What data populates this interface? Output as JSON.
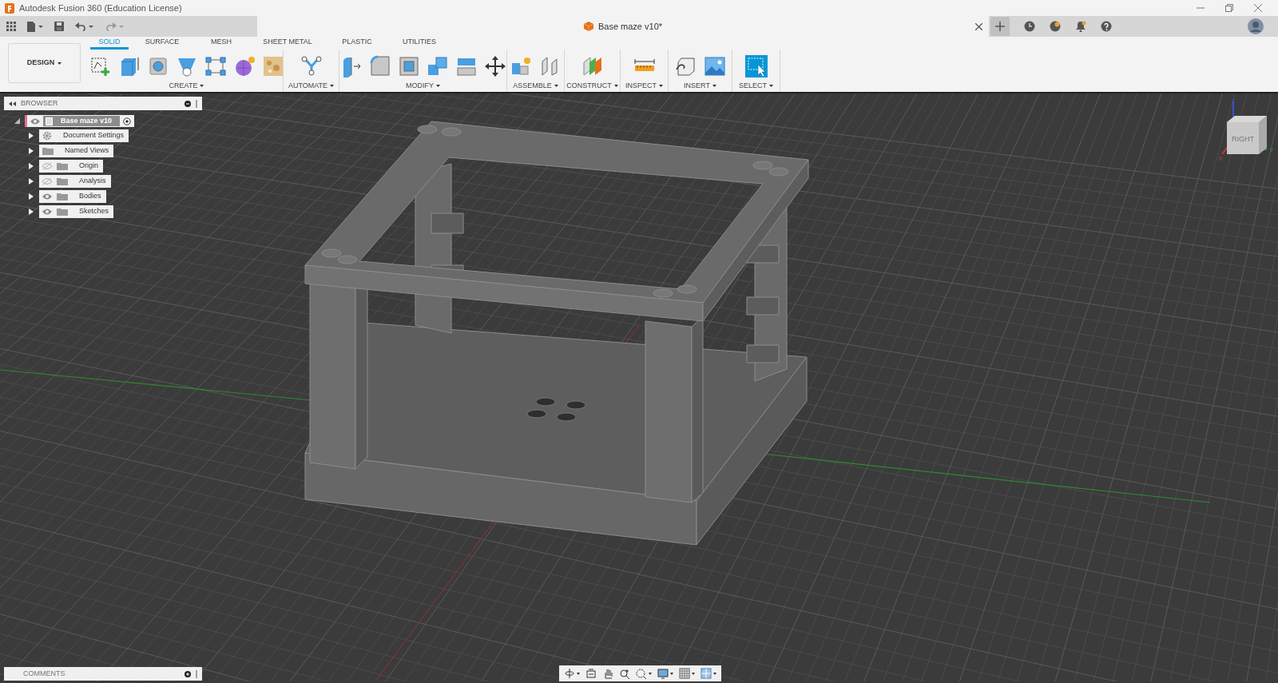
{
  "window": {
    "title": "Autodesk Fusion 360 (Education License)"
  },
  "document_tab": {
    "title": "Base maze v10*"
  },
  "workspace": {
    "label": "DESIGN"
  },
  "workspace_tabs": [
    {
      "label": "SOLID",
      "selected": true
    },
    {
      "label": "SURFACE",
      "selected": false
    },
    {
      "label": "MESH",
      "selected": false
    },
    {
      "label": "SHEET METAL",
      "selected": false
    },
    {
      "label": "PLASTIC",
      "selected": false
    },
    {
      "label": "UTILITIES",
      "selected": false
    }
  ],
  "tool_groups": [
    {
      "label": "CREATE"
    },
    {
      "label": "AUTOMATE"
    },
    {
      "label": "MODIFY"
    },
    {
      "label": "ASSEMBLE"
    },
    {
      "label": "CONSTRUCT"
    },
    {
      "label": "INSPECT"
    },
    {
      "label": "INSERT"
    },
    {
      "label": "SELECT"
    }
  ],
  "browser": {
    "title": "BROWSER",
    "root": {
      "label": "Base maze v10",
      "expanded": true,
      "visible": true,
      "active": true,
      "children": [
        {
          "label": "Document Settings",
          "kind": "settings",
          "expanded": false
        },
        {
          "label": "Named Views",
          "kind": "folder",
          "expanded": false
        },
        {
          "label": "Origin",
          "kind": "folder",
          "expanded": false,
          "visible": false
        },
        {
          "label": "Analysis",
          "kind": "folder",
          "expanded": false,
          "visible": false
        },
        {
          "label": "Bodies",
          "kind": "folder",
          "expanded": false,
          "visible": true
        },
        {
          "label": "Sketches",
          "kind": "folder",
          "expanded": false,
          "visible": true
        }
      ]
    }
  },
  "view_cube": {
    "face": "RIGHT",
    "axes": [
      "Z",
      "Y",
      "X"
    ]
  },
  "comments": {
    "title": "COMMENTS"
  }
}
